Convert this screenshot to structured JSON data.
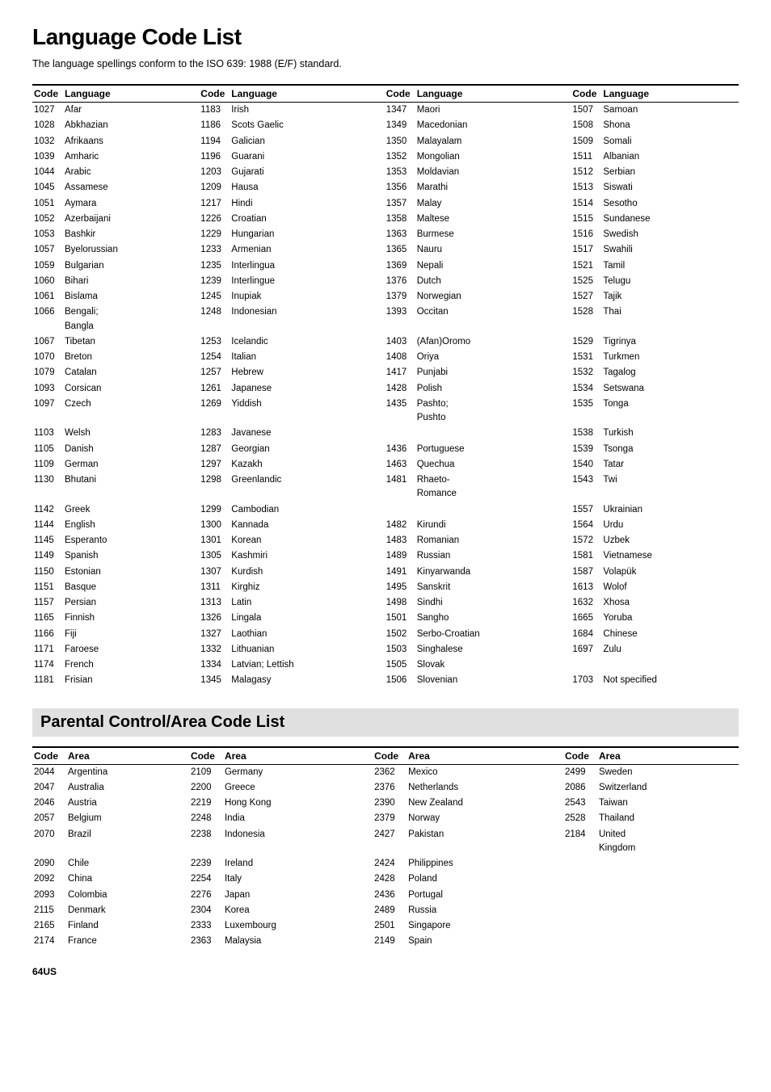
{
  "page": {
    "title": "Language Code List",
    "subtitle": "The language spellings conform to the ISO 639: 1988 (E/F) standard.",
    "section2_title": "Parental Control/Area Code List",
    "page_number": "64US"
  },
  "language_columns": [
    {
      "header_code": "Code",
      "header_lang": "Language",
      "rows": [
        [
          "1027",
          "Afar"
        ],
        [
          "1028",
          "Abkhazian"
        ],
        [
          "1032",
          "Afrikaans"
        ],
        [
          "1039",
          "Amharic"
        ],
        [
          "1044",
          "Arabic"
        ],
        [
          "1045",
          "Assamese"
        ],
        [
          "1051",
          "Aymara"
        ],
        [
          "1052",
          "Azerbaijani"
        ],
        [
          "1053",
          "Bashkir"
        ],
        [
          "1057",
          "Byelorussian"
        ],
        [
          "1059",
          "Bulgarian"
        ],
        [
          "1060",
          "Bihari"
        ],
        [
          "1061",
          "Bislama"
        ],
        [
          "1066",
          "Bengali;\nBangla"
        ],
        [
          "1067",
          "Tibetan"
        ],
        [
          "1070",
          "Breton"
        ],
        [
          "1079",
          "Catalan"
        ],
        [
          "1093",
          "Corsican"
        ],
        [
          "1097",
          "Czech"
        ],
        [
          "1103",
          "Welsh"
        ],
        [
          "1105",
          "Danish"
        ],
        [
          "1109",
          "German"
        ],
        [
          "1130",
          "Bhutani"
        ],
        [
          "1142",
          "Greek"
        ],
        [
          "1144",
          "English"
        ],
        [
          "1145",
          "Esperanto"
        ],
        [
          "1149",
          "Spanish"
        ],
        [
          "1150",
          "Estonian"
        ],
        [
          "1151",
          "Basque"
        ],
        [
          "1157",
          "Persian"
        ],
        [
          "1165",
          "Finnish"
        ],
        [
          "1166",
          "Fiji"
        ],
        [
          "1171",
          "Faroese"
        ],
        [
          "1174",
          "French"
        ],
        [
          "1181",
          "Frisian"
        ]
      ]
    },
    {
      "header_code": "Code",
      "header_lang": "Language",
      "rows": [
        [
          "1183",
          "Irish"
        ],
        [
          "1186",
          "Scots Gaelic"
        ],
        [
          "1194",
          "Galician"
        ],
        [
          "1196",
          "Guarani"
        ],
        [
          "1203",
          "Gujarati"
        ],
        [
          "1209",
          "Hausa"
        ],
        [
          "1217",
          "Hindi"
        ],
        [
          "1226",
          "Croatian"
        ],
        [
          "1229",
          "Hungarian"
        ],
        [
          "1233",
          "Armenian"
        ],
        [
          "1235",
          "Interlingua"
        ],
        [
          "1239",
          "Interlingue"
        ],
        [
          "1245",
          "Inupiak"
        ],
        [
          "1248",
          "Indonesian"
        ],
        [
          "1253",
          "Icelandic"
        ],
        [
          "1254",
          "Italian"
        ],
        [
          "1257",
          "Hebrew"
        ],
        [
          "1261",
          "Japanese"
        ],
        [
          "1269",
          "Yiddish"
        ],
        [
          "1283",
          "Javanese"
        ],
        [
          "1287",
          "Georgian"
        ],
        [
          "1297",
          "Kazakh"
        ],
        [
          "1298",
          "Greenlandic"
        ],
        [
          "1299",
          "Cambodian"
        ],
        [
          "1300",
          "Kannada"
        ],
        [
          "1301",
          "Korean"
        ],
        [
          "1305",
          "Kashmiri"
        ],
        [
          "1307",
          "Kurdish"
        ],
        [
          "1311",
          "Kirghiz"
        ],
        [
          "1313",
          "Latin"
        ],
        [
          "1326",
          "Lingala"
        ],
        [
          "1327",
          "Laothian"
        ],
        [
          "1332",
          "Lithuanian"
        ],
        [
          "1334",
          "Latvian; Lettish"
        ],
        [
          "1345",
          "Malagasy"
        ]
      ]
    },
    {
      "header_code": "Code",
      "header_lang": "Language",
      "rows": [
        [
          "1347",
          "Maori"
        ],
        [
          "1349",
          "Macedonian"
        ],
        [
          "1350",
          "Malayalam"
        ],
        [
          "1352",
          "Mongolian"
        ],
        [
          "1353",
          "Moldavian"
        ],
        [
          "1356",
          "Marathi"
        ],
        [
          "1357",
          "Malay"
        ],
        [
          "1358",
          "Maltese"
        ],
        [
          "1363",
          "Burmese"
        ],
        [
          "1365",
          "Nauru"
        ],
        [
          "1369",
          "Nepali"
        ],
        [
          "1376",
          "Dutch"
        ],
        [
          "1379",
          "Norwegian"
        ],
        [
          "1393",
          "Occitan"
        ],
        [
          "1403",
          "(Afan)Oromo"
        ],
        [
          "1408",
          "Oriya"
        ],
        [
          "1417",
          "Punjabi"
        ],
        [
          "1428",
          "Polish"
        ],
        [
          "1435",
          "Pashto;\nPushto"
        ],
        [
          "",
          ""
        ],
        [
          "1436",
          "Portuguese"
        ],
        [
          "1463",
          "Quechua"
        ],
        [
          "1481",
          "Rhaeto-\nRomance"
        ],
        [
          "",
          ""
        ],
        [
          "1482",
          "Kirundi"
        ],
        [
          "1483",
          "Romanian"
        ],
        [
          "1489",
          "Russian"
        ],
        [
          "1491",
          "Kinyarwanda"
        ],
        [
          "1495",
          "Sanskrit"
        ],
        [
          "1498",
          "Sindhi"
        ],
        [
          "1501",
          "Sangho"
        ],
        [
          "1502",
          "Serbo-Croatian"
        ],
        [
          "1503",
          "Singhalese"
        ],
        [
          "1505",
          "Slovak"
        ],
        [
          "1506",
          "Slovenian"
        ]
      ]
    },
    {
      "header_code": "Code",
      "header_lang": "Language",
      "rows": [
        [
          "1507",
          "Samoan"
        ],
        [
          "1508",
          "Shona"
        ],
        [
          "1509",
          "Somali"
        ],
        [
          "1511",
          "Albanian"
        ],
        [
          "1512",
          "Serbian"
        ],
        [
          "1513",
          "Siswati"
        ],
        [
          "1514",
          "Sesotho"
        ],
        [
          "1515",
          "Sundanese"
        ],
        [
          "1516",
          "Swedish"
        ],
        [
          "1517",
          "Swahili"
        ],
        [
          "1521",
          "Tamil"
        ],
        [
          "1525",
          "Telugu"
        ],
        [
          "1527",
          "Tajik"
        ],
        [
          "1528",
          "Thai"
        ],
        [
          "1529",
          "Tigrinya"
        ],
        [
          "1531",
          "Turkmen"
        ],
        [
          "1532",
          "Tagalog"
        ],
        [
          "1534",
          "Setswana"
        ],
        [
          "1535",
          "Tonga"
        ],
        [
          "1538",
          "Turkish"
        ],
        [
          "1539",
          "Tsonga"
        ],
        [
          "1540",
          "Tatar"
        ],
        [
          "1543",
          "Twi"
        ],
        [
          "1557",
          "Ukrainian"
        ],
        [
          "1564",
          "Urdu"
        ],
        [
          "1572",
          "Uzbek"
        ],
        [
          "1581",
          "Vietnamese"
        ],
        [
          "1587",
          "Volapük"
        ],
        [
          "1613",
          "Wolof"
        ],
        [
          "1632",
          "Xhosa"
        ],
        [
          "1665",
          "Yoruba"
        ],
        [
          "1684",
          "Chinese"
        ],
        [
          "1697",
          "Zulu"
        ],
        [
          "",
          ""
        ],
        [
          "1703",
          "Not specified"
        ]
      ]
    }
  ],
  "area_columns": [
    {
      "header_code": "Code",
      "header_area": "Area",
      "rows": [
        [
          "2044",
          "Argentina"
        ],
        [
          "2047",
          "Australia"
        ],
        [
          "2046",
          "Austria"
        ],
        [
          "2057",
          "Belgium"
        ],
        [
          "2070",
          "Brazil"
        ],
        [
          "2090",
          "Chile"
        ],
        [
          "2092",
          "China"
        ],
        [
          "2093",
          "Colombia"
        ],
        [
          "2115",
          "Denmark"
        ],
        [
          "2165",
          "Finland"
        ],
        [
          "2174",
          "France"
        ]
      ]
    },
    {
      "header_code": "Code",
      "header_area": "Area",
      "rows": [
        [
          "2109",
          "Germany"
        ],
        [
          "2200",
          "Greece"
        ],
        [
          "2219",
          "Hong Kong"
        ],
        [
          "2248",
          "India"
        ],
        [
          "2238",
          "Indonesia"
        ],
        [
          "2239",
          "Ireland"
        ],
        [
          "2254",
          "Italy"
        ],
        [
          "2276",
          "Japan"
        ],
        [
          "2304",
          "Korea"
        ],
        [
          "2333",
          "Luxembourg"
        ],
        [
          "2363",
          "Malaysia"
        ]
      ]
    },
    {
      "header_code": "Code",
      "header_area": "Area",
      "rows": [
        [
          "2362",
          "Mexico"
        ],
        [
          "2376",
          "Netherlands"
        ],
        [
          "2390",
          "New Zealand"
        ],
        [
          "2379",
          "Norway"
        ],
        [
          "2427",
          "Pakistan"
        ],
        [
          "2424",
          "Philippines"
        ],
        [
          "2428",
          "Poland"
        ],
        [
          "2436",
          "Portugal"
        ],
        [
          "2489",
          "Russia"
        ],
        [
          "2501",
          "Singapore"
        ],
        [
          "2149",
          "Spain"
        ]
      ]
    },
    {
      "header_code": "Code",
      "header_area": "Area",
      "rows": [
        [
          "2499",
          "Sweden"
        ],
        [
          "2086",
          "Switzerland"
        ],
        [
          "2543",
          "Taiwan"
        ],
        [
          "2528",
          "Thailand"
        ],
        [
          "2184",
          "United\nKingdom"
        ]
      ]
    }
  ]
}
